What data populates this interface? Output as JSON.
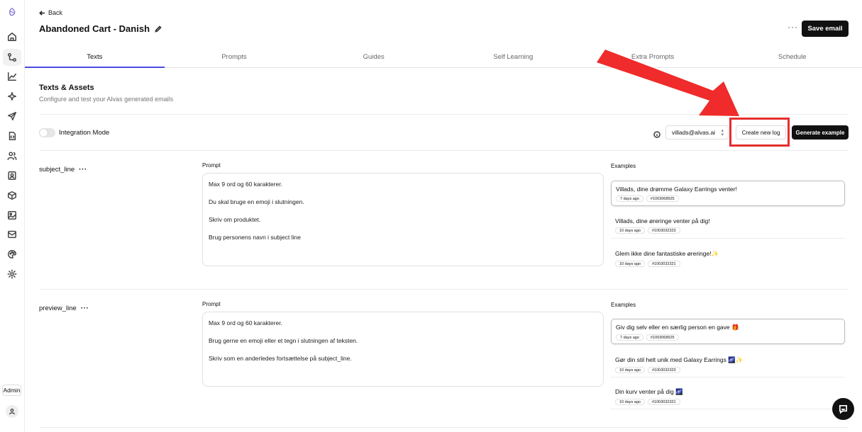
{
  "sidebar": {
    "icons": [
      "logo-icon",
      "home-icon",
      "flow-icon",
      "chart-icon",
      "sparkle-icon",
      "send-icon",
      "code-doc-icon",
      "users-icon",
      "contact-card-icon",
      "box-icon",
      "image-icon",
      "mail-icon",
      "palette-icon",
      "gear-icon"
    ],
    "admin_label": "Admin"
  },
  "header": {
    "back_label": "Back",
    "title": "Abandoned Cart - Danish",
    "more": "···",
    "save_label": "Save email"
  },
  "tabs": [
    {
      "label": "Texts",
      "active": true
    },
    {
      "label": "Prompts"
    },
    {
      "label": "Guides"
    },
    {
      "label": "Self Learning"
    },
    {
      "label": "Extra Prompts"
    },
    {
      "label": "Schedule"
    }
  ],
  "section": {
    "title": "Texts & Assets",
    "subtitle": "Configure and test your Alvas generated emails"
  },
  "controls": {
    "integration_label": "Integration Mode",
    "email_select": "villads@alvas.ai",
    "create_log_label": "Create new log",
    "generate_label": "Generate example"
  },
  "fields": [
    {
      "name": "subject_line",
      "dots": "···",
      "prompt_label": "Prompt",
      "examples_label": "Examples",
      "prompt_lines": [
        "Max 9 ord og 60 karakterer.",
        "Du skal bruge en emoji i slutningen.",
        "Skriv om produktet.",
        "Brug personens navn i subject line"
      ],
      "examples": [
        {
          "text": "Villads, dine drømme Galaxy Earrings venter!",
          "age": "7 days ago",
          "id": "#1003068925"
        },
        {
          "text": "Villads, dine øreringe venter på dig!",
          "age": "10 days ago",
          "id": "#1003032323"
        },
        {
          "text": "Glem ikke dine fantastiske øreringe!✨",
          "age": "10 days ago",
          "id": "#1003032321"
        }
      ]
    },
    {
      "name": "preview_line",
      "dots": "···",
      "prompt_label": "Prompt",
      "examples_label": "Examples",
      "prompt_lines": [
        "Max 9 ord og 60 karakterer.",
        "Brug gerne en emoji eller et tegn i slutningen af teksten.",
        "Skriv som en anderledes fortsættelse på subject_line."
      ],
      "examples": [
        {
          "text": "Giv dig selv eller en særlig person en gave 🎁",
          "age": "7 days ago",
          "id": "#1003068925"
        },
        {
          "text": "Gør din stil helt unik med Galaxy Earrings 🌌✨",
          "age": "10 days ago",
          "id": "#1003032323"
        },
        {
          "text": "Din kurv venter på dig 🌌",
          "age": "10 days ago",
          "id": "#1003032321"
        }
      ]
    }
  ],
  "colors": {
    "accent": "#4b4be0",
    "annotation_red": "#e52e2e",
    "primary_button": "#111111"
  }
}
